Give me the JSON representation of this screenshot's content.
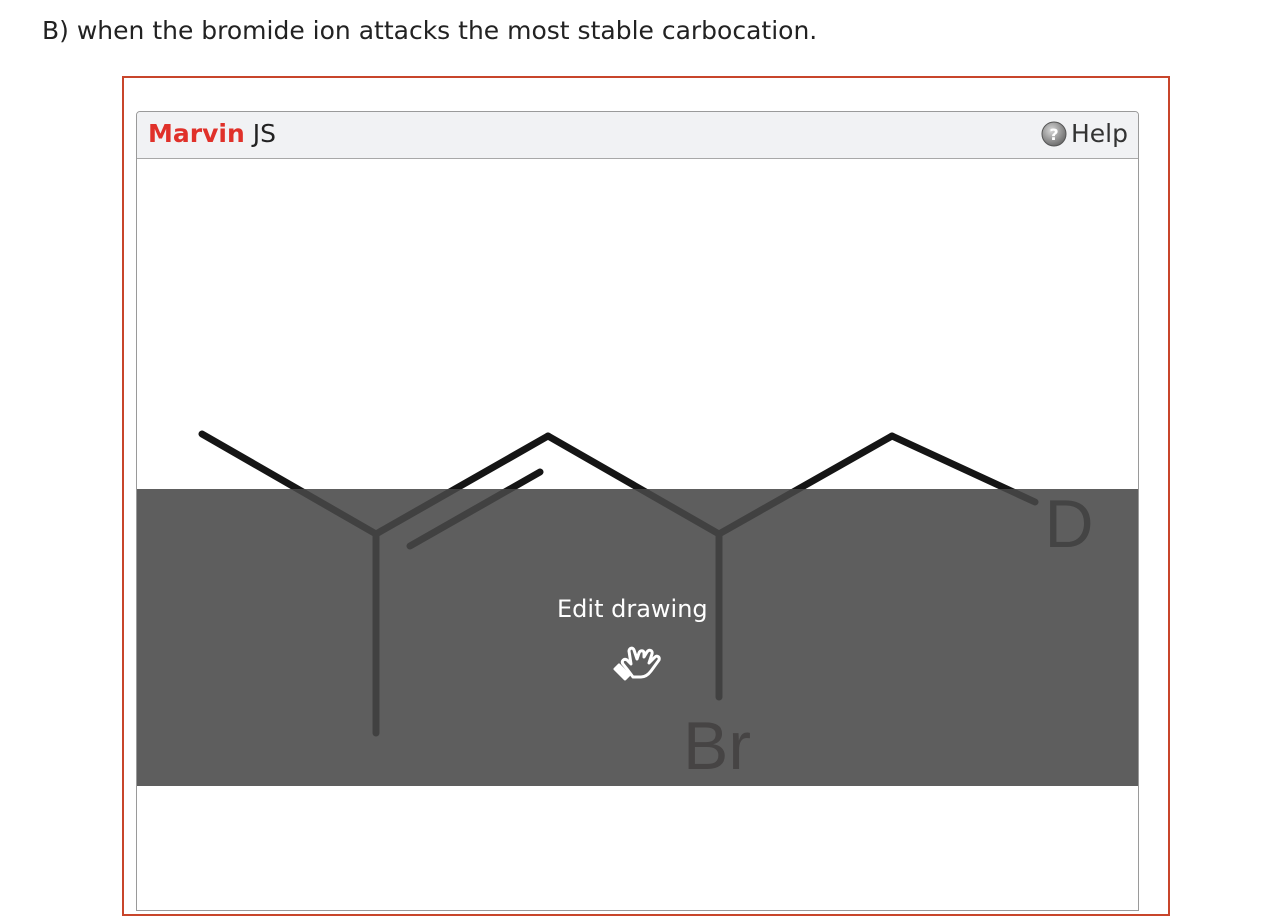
{
  "question": {
    "text": "B) when the bromide ion attacks the most stable carbocation."
  },
  "editor": {
    "brand_primary": "Marvin",
    "brand_secondary": "JS",
    "help_label": "Help",
    "help_icon": "help-circle-icon",
    "colors": {
      "brand_red": "#e0312a",
      "frame_border": "#c8452b",
      "overlay": "#5a5a5a"
    }
  },
  "molecule": {
    "atoms": {
      "bromine": "Br",
      "deuterium": "D"
    }
  },
  "overlay": {
    "label": "Edit drawing",
    "icon": "pointing-hand-icon"
  }
}
